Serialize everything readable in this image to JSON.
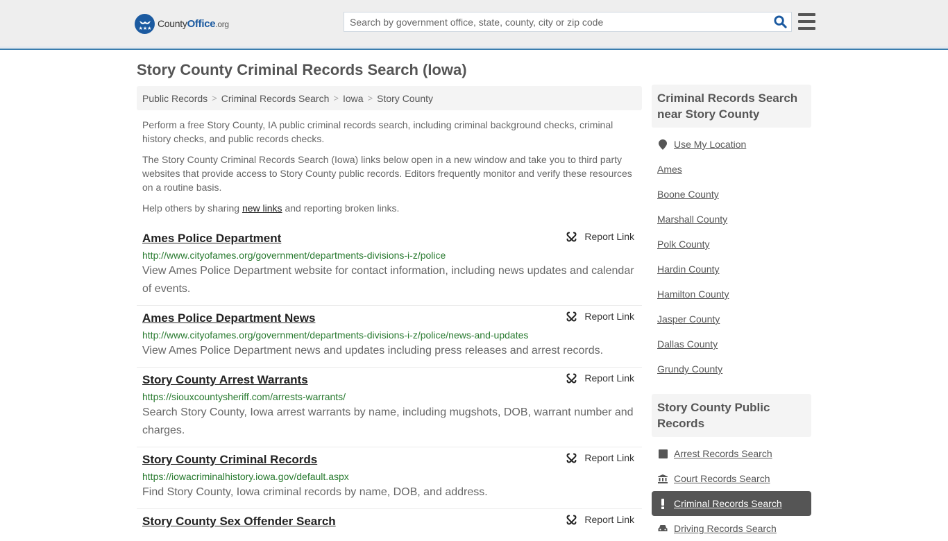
{
  "header": {
    "logo": {
      "name": "County",
      "name_bold": "Office",
      "tld": ".org"
    },
    "search": {
      "placeholder": "Search by government office, state, county, city or zip code",
      "value": ""
    },
    "icons": {
      "search": "search-icon",
      "menu": "hamburger-menu-icon",
      "logo": "eagle-stars-badge-icon"
    }
  },
  "page": {
    "title": "Story County Criminal Records Search (Iowa)",
    "breadcrumb": [
      "Public Records",
      "Criminal Records Search",
      "Iowa",
      "Story County"
    ],
    "breadcrumb_separator": ">",
    "intro": {
      "p1": "Perform a free Story County, IA public criminal records search, including criminal background checks, criminal history checks, and public records checks.",
      "p2": "The Story County Criminal Records Search (Iowa) links below open in a new window and take you to third party websites that provide access to Story County public records. Editors frequently monitor and verify these resources on a routine basis.",
      "p3_before": "Help others by sharing ",
      "p3_link": "new links",
      "p3_after": " and reporting broken links."
    },
    "report_label": "Report Link",
    "links": [
      {
        "title": "Ames Police Department",
        "url": "http://www.cityofames.org/government/departments-divisions-i-z/police",
        "description": "View Ames Police Department website for contact information, including news updates and calendar of events."
      },
      {
        "title": "Ames Police Department News",
        "url": "http://www.cityofames.org/government/departments-divisions-i-z/police/news-and-updates",
        "description": "View Ames Police Department news and updates including press releases and arrest records."
      },
      {
        "title": "Story County Arrest Warrants",
        "url": "https://siouxcountysheriff.com/arrests-warrants/",
        "description": "Search Story County, Iowa arrest warrants by name, including mugshots, DOB, warrant number and charges."
      },
      {
        "title": "Story County Criminal Records",
        "url": "https://iowacriminalhistory.iowa.gov/default.aspx",
        "description": "Find Story County, Iowa criminal records by name, DOB, and address."
      },
      {
        "title": "Story County Sex Offender Search",
        "url": "",
        "description": ""
      }
    ]
  },
  "sidebar": {
    "nearby": {
      "heading": "Criminal Records Search near Story County",
      "use_location": "Use My Location",
      "items": [
        "Ames",
        "Boone County",
        "Marshall County",
        "Polk County",
        "Hardin County",
        "Hamilton County",
        "Jasper County",
        "Dallas County",
        "Grundy County"
      ]
    },
    "public_records": {
      "heading": "Story County Public Records",
      "items": [
        {
          "label": "Arrest Records Search",
          "icon": "square-icon",
          "active": false
        },
        {
          "label": "Court Records Search",
          "icon": "courthouse-icon",
          "active": false
        },
        {
          "label": "Criminal Records Search",
          "icon": "exclamation-icon",
          "active": true
        },
        {
          "label": "Driving Records Search",
          "icon": "car-icon",
          "active": false
        }
      ]
    }
  },
  "colors": {
    "brand_blue": "#1b5aa0",
    "header_border": "#3a7dae",
    "url_green": "#287a2f",
    "active_bg": "#555555"
  }
}
